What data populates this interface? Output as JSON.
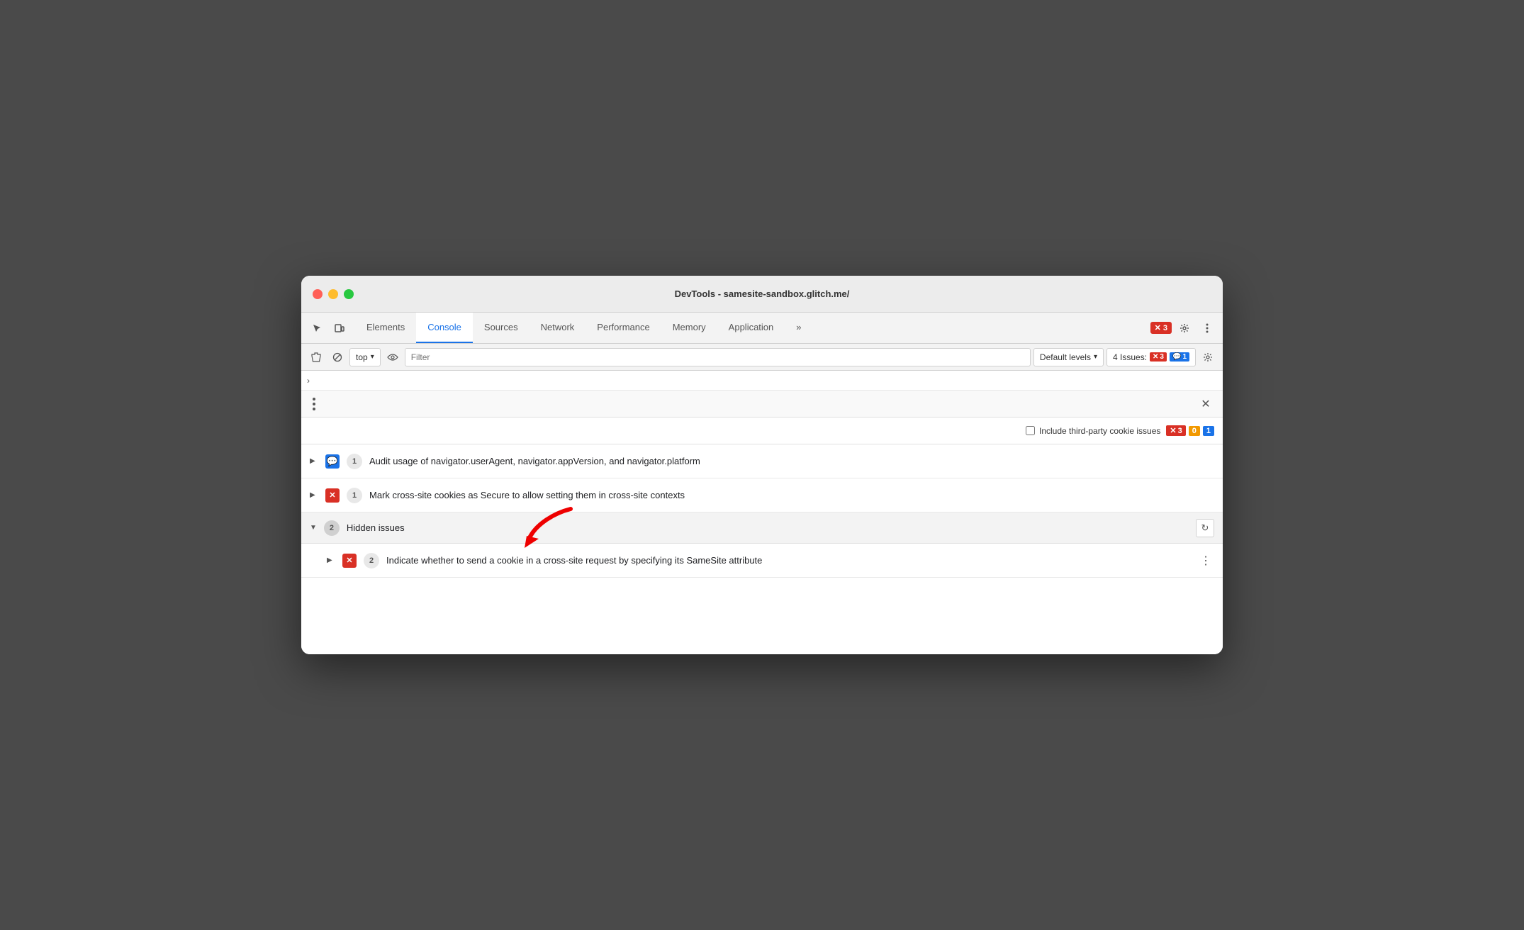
{
  "window": {
    "title": "DevTools - samesite-sandbox.glitch.me/"
  },
  "tabs": {
    "items": [
      {
        "label": "Elements",
        "active": false
      },
      {
        "label": "Console",
        "active": true
      },
      {
        "label": "Sources",
        "active": false
      },
      {
        "label": "Network",
        "active": false
      },
      {
        "label": "Performance",
        "active": false
      },
      {
        "label": "Memory",
        "active": false
      },
      {
        "label": "Application",
        "active": false
      }
    ],
    "more_label": "»",
    "error_count": "3"
  },
  "console_toolbar": {
    "top_label": "top",
    "filter_placeholder": "Filter",
    "default_levels_label": "Default levels",
    "issues_label": "4 Issues:",
    "error_count": "3",
    "info_count": "1"
  },
  "issues_panel": {
    "header": {
      "menu_label": "⋮",
      "close_label": "✕"
    },
    "include_bar": {
      "checkbox_label": "Include third-party cookie issues",
      "error_count": "3",
      "warning_count": "0",
      "info_count": "1"
    },
    "issues": [
      {
        "type": "info",
        "count": "1",
        "text": "Audit usage of navigator.userAgent, navigator.appVersion, and navigator.platform"
      },
      {
        "type": "error",
        "count": "1",
        "text": "Mark cross-site cookies as Secure to allow setting them in cross-site contexts"
      }
    ],
    "hidden_group": {
      "count": "2",
      "label": "Hidden issues",
      "nested": [
        {
          "type": "error",
          "count": "2",
          "text": "Indicate whether to send a cookie in a cross-site request by specifying its SameSite attribute"
        }
      ]
    }
  }
}
